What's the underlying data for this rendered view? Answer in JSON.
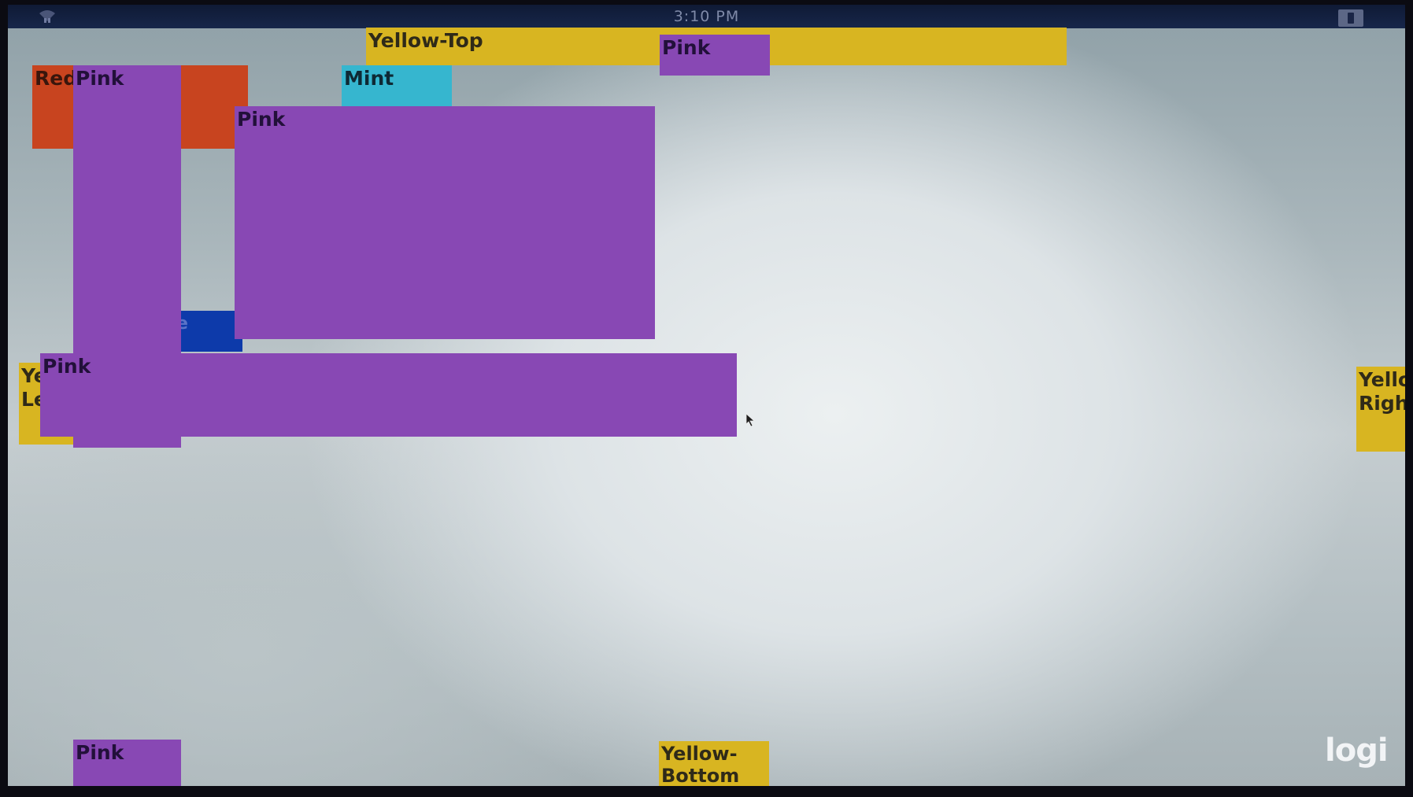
{
  "statusbar": {
    "time": "3:10 PM",
    "left_icon": "network-icon",
    "right_icon": "screen-icon"
  },
  "boxes": {
    "yellow_top": "Yellow-Top",
    "pink_top": "Pink",
    "red": "Red",
    "pink_tall": "Pink",
    "mint": "Mint",
    "pink_large": "Pink",
    "blue": "e",
    "yellow_left": "Ye\nLe",
    "pink_wide": "Pink",
    "yellow_right": "Yello\nRigh",
    "pink_bottom": "Pink",
    "yellow_bottom": "Yellow-\nBottom"
  },
  "brand": {
    "logo": "logi"
  },
  "colors": {
    "yellow": "#d8b521",
    "pink": "#8848b4",
    "red": "#c8441f",
    "mint": "#36b6cf",
    "blue": "#0d3aaa",
    "statusbar": "#17264a"
  }
}
